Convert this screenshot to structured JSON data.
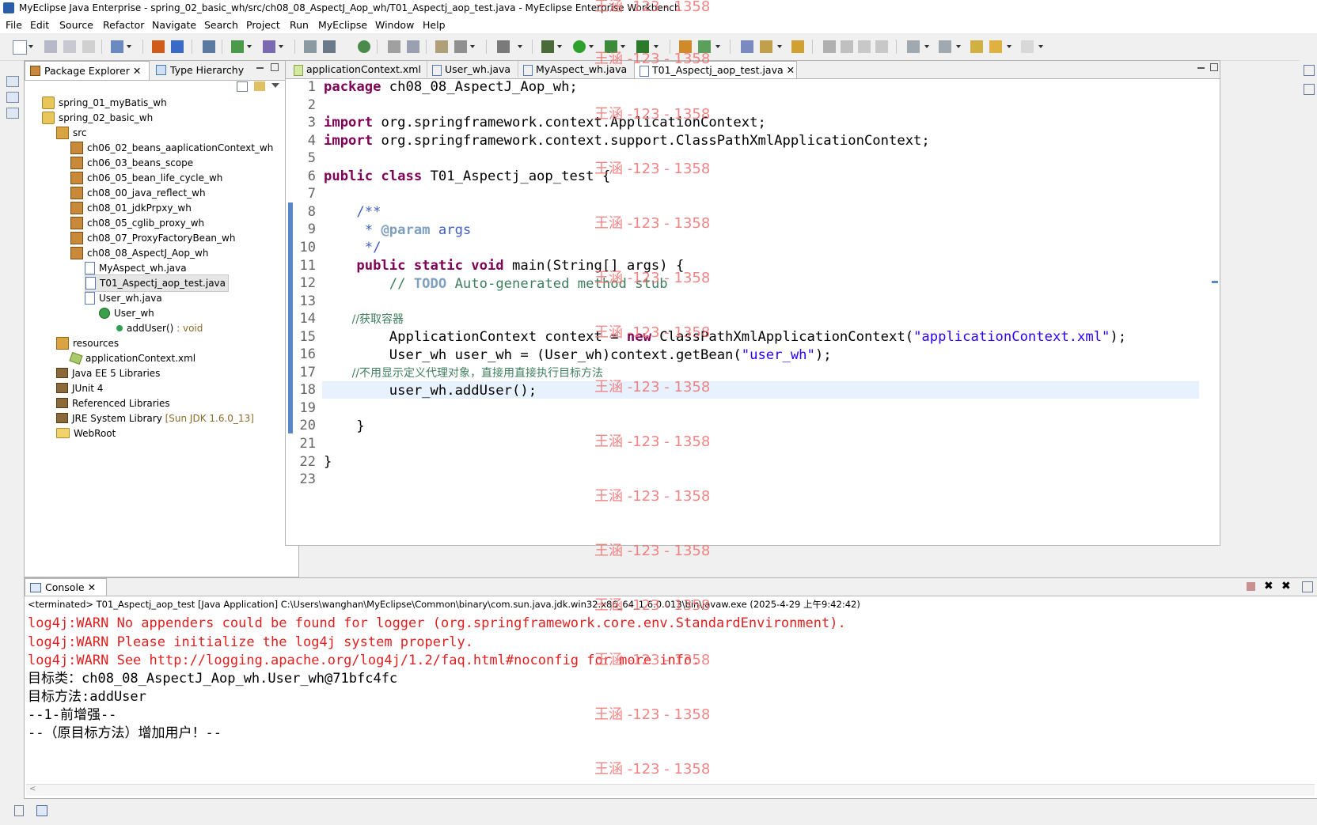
{
  "window": {
    "title": "MyEclipse Java Enterprise - spring_02_basic_wh/src/ch08_08_AspectJ_Aop_wh/T01_Aspectj_aop_test.java - MyEclipse Enterprise Workbench"
  },
  "menu": [
    "File",
    "Edit",
    "Source",
    "Refactor",
    "Navigate",
    "Search",
    "Project",
    "Run",
    "MyEclipse",
    "Window",
    "Help"
  ],
  "package_explorer": {
    "tab_label": "Package Explorer",
    "type_hierarchy_label": "Type Hierarchy",
    "tree": [
      {
        "label": "spring_01_myBatis_wh",
        "icon": "project-icon"
      },
      {
        "label": "spring_02_basic_wh",
        "icon": "project-icon"
      },
      {
        "label": "src",
        "icon": "source-folder-icon"
      },
      {
        "label": "ch06_02_beans_aaplicationContext_wh",
        "icon": "package-icon"
      },
      {
        "label": "ch06_03_beans_scope",
        "icon": "package-icon"
      },
      {
        "label": "ch06_05_bean_life_cycle_wh",
        "icon": "package-icon"
      },
      {
        "label": "ch08_00_java_reflect_wh",
        "icon": "package-icon"
      },
      {
        "label": "ch08_01_jdkPrpxy_wh",
        "icon": "package-icon"
      },
      {
        "label": "ch08_05_cglib_proxy_wh",
        "icon": "package-icon"
      },
      {
        "label": "ch08_07_ProxyFactoryBean_wh",
        "icon": "package-icon"
      },
      {
        "label": "ch08_08_AspectJ_Aop_wh",
        "icon": "package-icon"
      },
      {
        "label": "MyAspect_wh.java",
        "icon": "java-file-icon"
      },
      {
        "label": "T01_Aspectj_aop_test.java",
        "icon": "java-file-icon"
      },
      {
        "label": "User_wh.java",
        "icon": "java-file-icon"
      },
      {
        "label": "User_wh",
        "icon": "class-icon"
      },
      {
        "label": "addUser()",
        "suffix": " : void",
        "icon": "method-icon"
      },
      {
        "label": "resources",
        "icon": "source-folder-icon"
      },
      {
        "label": "applicationContext.xml",
        "icon": "xml-file-icon"
      },
      {
        "label": "Java EE 5 Libraries",
        "icon": "library-icon"
      },
      {
        "label": "JUnit 4",
        "icon": "library-icon"
      },
      {
        "label": "Referenced Libraries",
        "icon": "library-icon"
      },
      {
        "label": "JRE System Library",
        "suffix": " [Sun JDK 1.6.0_13]",
        "icon": "library-icon"
      },
      {
        "label": "WebRoot",
        "icon": "folder-icon"
      }
    ]
  },
  "editor": {
    "tabs": [
      "applicationContext.xml",
      "User_wh.java",
      "MyAspect_wh.java",
      "T01_Aspectj_aop_test.java"
    ],
    "line_numbers": [
      "1",
      "2",
      "3",
      "4",
      "5",
      "6",
      "7",
      "8",
      "9",
      "10",
      "11",
      "12",
      "13",
      "14",
      "15",
      "16",
      "17",
      "18",
      "19",
      "20",
      "21",
      "22",
      "23"
    ],
    "code": {
      "l1_kw": "package",
      "l1_rest": " ch08_08_AspectJ_Aop_wh;",
      "l3_kw": "import",
      "l3_rest": " org.springframework.context.ApplicationContext;",
      "l4_kw": "import",
      "l4_rest": " org.springframework.context.support.ClassPathXmlApplicationContext;",
      "l6_kw": "public class",
      "l6_rest": " T01_Aspectj_aop_test {",
      "l8": "    /**",
      "l9_pre": "     * ",
      "l9_tag": "@param",
      "l9_rest": " args",
      "l10": "     */",
      "l11_kw": "    public static void",
      "l11_rest": " main(String[] args) {",
      "l12_pre": "        // ",
      "l12_todo": "TODO",
      "l12_rest": " Auto-generated method stub",
      "l14": "        //获取容器",
      "l15_a": "        ApplicationContext context = ",
      "l15_kw": "new",
      "l15_b": " ClassPathXmlApplicationContext(",
      "l15_str": "\"applicationContext.xml\"",
      "l15_c": ");",
      "l16_a": "        User_wh user_wh = (User_wh)context.getBean(",
      "l16_str": "\"user_wh\"",
      "l16_c": ");",
      "l17": "        //不用显示定义代理对象，直接用直接执行目标方法",
      "l18": "        user_wh.addUser();",
      "l20": "    }",
      "l22": "}"
    }
  },
  "console": {
    "tab_label": "Console",
    "header": "<terminated> T01_Aspectj_aop_test [Java Application] C:\\Users\\wanghan\\MyEclipse\\Common\\binary\\com.sun.java.jdk.win32.x86_64_1.6.0.013\\bin\\javaw.exe (2025-4-29 上午9:42:42)",
    "lines": [
      {
        "text": "log4j:WARN No appenders could be found for logger (org.springframework.core.env.StandardEnvironment).",
        "kind": "error"
      },
      {
        "text": "log4j:WARN Please initialize the log4j system properly.",
        "kind": "error"
      },
      {
        "text": "log4j:WARN See http://logging.apache.org/log4j/1.2/faq.html#noconfig for more info.",
        "kind": "error"
      },
      {
        "text": "目标类：ch08_08_AspectJ_Aop_wh.User_wh@71bfc4fc",
        "kind": "out"
      },
      {
        "text": "目标方法:addUser",
        "kind": "out"
      },
      {
        "text": "--1-前增强--",
        "kind": "out"
      },
      {
        "text": "--（原目标方法）增加用户！--",
        "kind": "out"
      }
    ]
  },
  "watermark": "王涵 -123 - 1358",
  "colors": {
    "keyword": "#7f0055",
    "string": "#2a00ff",
    "comment": "#3f7f5f",
    "javadoc": "#3f5fbf",
    "error": "#e02020",
    "watermark": "#f07070"
  }
}
